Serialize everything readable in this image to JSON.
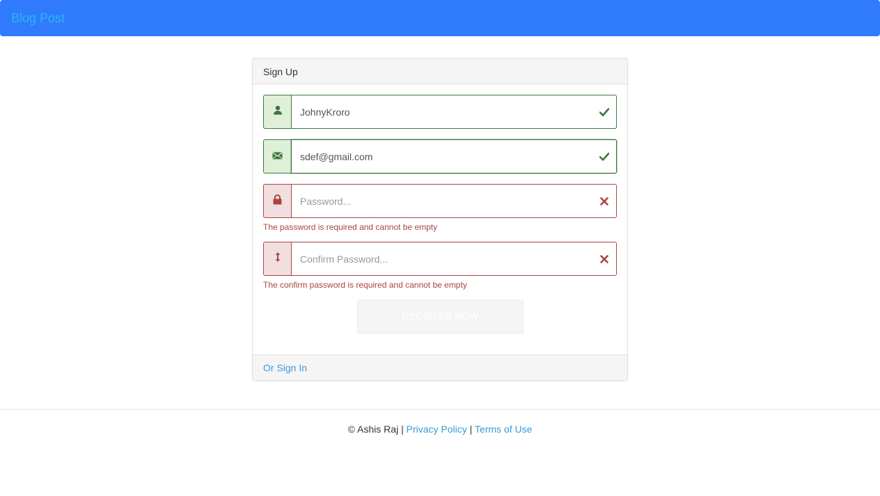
{
  "navbar": {
    "brand": "Blog Post"
  },
  "panel": {
    "heading": "Sign Up",
    "username": {
      "value": "JohnyKroro",
      "state": "success"
    },
    "email": {
      "value": "sdef@gmail.com",
      "state": "success"
    },
    "password": {
      "placeholder": "Password...",
      "state": "error",
      "error": "The password is required and cannot be empty"
    },
    "confirm": {
      "placeholder": "Confirm Password...",
      "state": "error",
      "error": "The confirm password is required and cannot be empty"
    },
    "register_label": "REGISTER NOW",
    "signin_link": "Or Sign In"
  },
  "footer": {
    "copyright": "© Ashis Raj",
    "sep1": "|",
    "privacy": "Privacy Policy",
    "sep2": "|",
    "terms": "Terms of Use"
  },
  "colors": {
    "navbar": "#2f7bfc",
    "brand": "#29b6f6",
    "success": "#3c763d",
    "error": "#a94442",
    "link": "#3a9ad9"
  },
  "icons": {
    "username": "user-icon",
    "email": "envelope-icon",
    "password": "lock-icon",
    "confirm": "resize-vertical-icon",
    "valid": "check-icon",
    "invalid": "cross-icon"
  }
}
